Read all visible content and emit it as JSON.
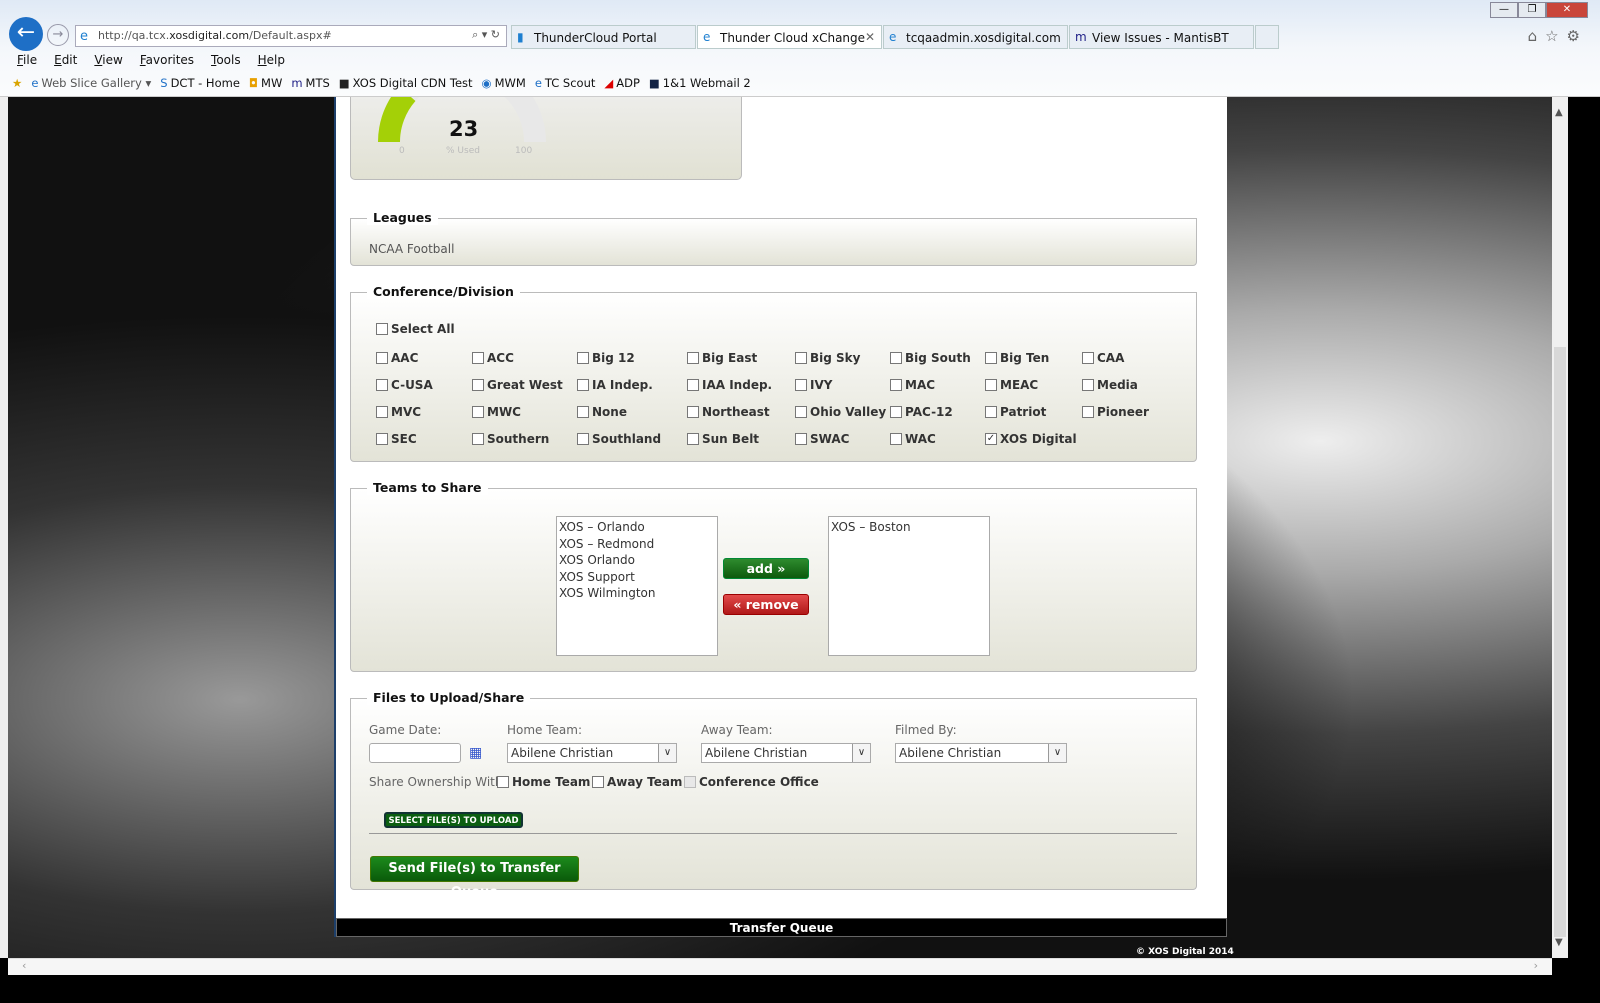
{
  "browser": {
    "url_prefix": "http://qa.tcx.",
    "url_domain": "xosdigital.com",
    "url_path": "/Default.aspx#",
    "tabs": [
      {
        "label": "ThunderCloud Portal",
        "active": false
      },
      {
        "label": "Thunder Cloud xChange",
        "active": true
      },
      {
        "label": "tcqaadmin.xosdigital.com",
        "active": false
      },
      {
        "label": "View Issues - MantisBT",
        "active": false
      }
    ],
    "menu": [
      "File",
      "Edit",
      "View",
      "Favorites",
      "Tools",
      "Help"
    ],
    "favorites": [
      "Web Slice Gallery ▾",
      "DCT - Home",
      "MW",
      "MTS",
      "XOS Digital CDN Test",
      "MWM",
      "TC Scout",
      "ADP",
      "1&1 Webmail 2"
    ]
  },
  "gauge": {
    "value": "23",
    "label": "% Used",
    "min": "0",
    "max": "100",
    "percent": 23,
    "color": "#a4d007"
  },
  "leagues": {
    "title": "Leagues",
    "value": "NCAA Football"
  },
  "conference": {
    "title": "Conference/Division",
    "select_all": "Select All",
    "rows": [
      [
        "AAC",
        "ACC",
        "Big 12",
        "Big East",
        "Big Sky",
        "Big South",
        "Big Ten",
        "CAA"
      ],
      [
        "C-USA",
        "Great West",
        "IA Indep.",
        "IAA Indep.",
        "IVY",
        "MAC",
        "MEAC",
        "Media"
      ],
      [
        "MVC",
        "MWC",
        "None",
        "Northeast",
        "Ohio Valley",
        "PAC-12",
        "Patriot",
        "Pioneer"
      ],
      [
        "SEC",
        "Southern",
        "Southland",
        "Sun Belt",
        "SWAC",
        "WAC",
        "XOS Digital"
      ]
    ],
    "checked": [
      "XOS Digital"
    ]
  },
  "teams": {
    "title": "Teams to Share",
    "available": [
      "XOS – Orlando",
      "XOS – Redmond",
      "XOS Orlando",
      "XOS Support",
      "XOS Wilmington"
    ],
    "selected": [
      "XOS – Boston"
    ],
    "add_label": "add »",
    "remove_label": "« remove"
  },
  "files": {
    "title": "Files to Upload/Share",
    "game_date_label": "Game Date:",
    "game_date_value": "",
    "home_label": "Home Team:",
    "home_value": "Abilene Christian",
    "away_label": "Away Team:",
    "away_value": "Abilene Christian",
    "filmed_label": "Filmed By:",
    "filmed_value": "Abilene Christian",
    "share_label": "Share Ownership With:",
    "share_home": "Home Team",
    "share_away": "Away Team",
    "share_conf": "Conference Office",
    "select_files": "SELECT FILE(S) TO UPLOAD",
    "send": "Send File(s) to Transfer Queue"
  },
  "transfer_queue": "Transfer Queue",
  "footer": "© XOS Digital 2014"
}
